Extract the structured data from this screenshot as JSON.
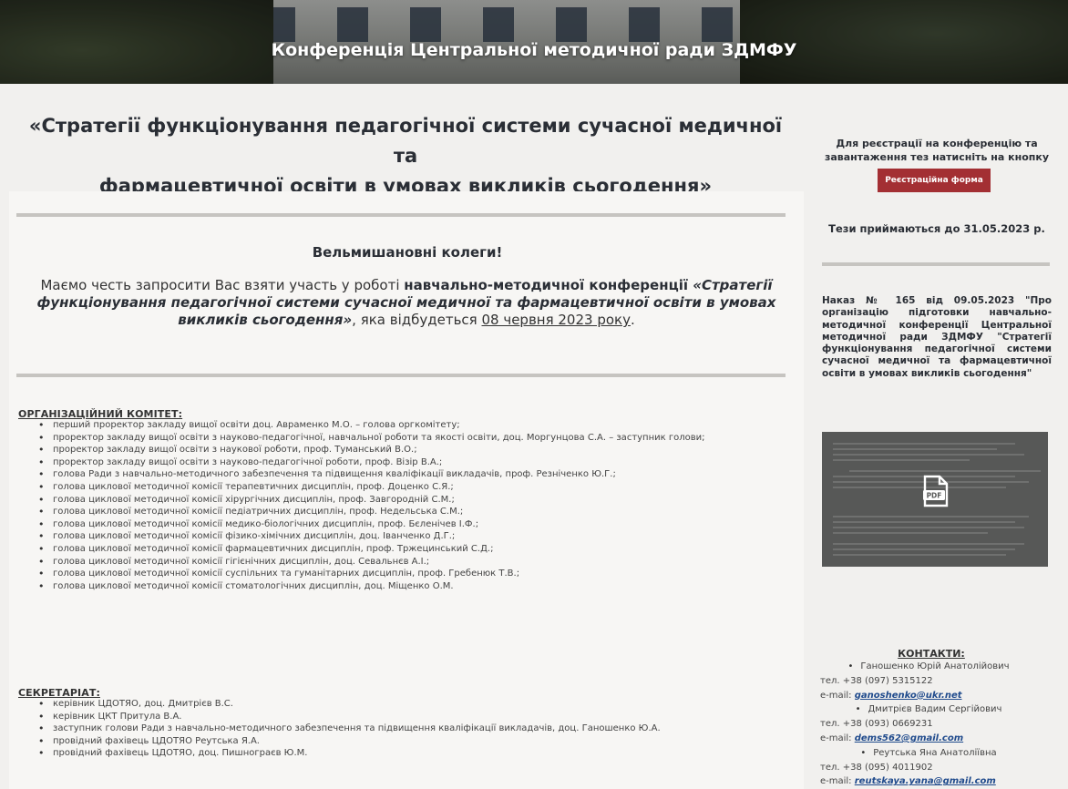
{
  "banner": {
    "title": "Конференція Центральної методичної ради ЗДМФУ"
  },
  "main": {
    "conf_title_line1": "«Стратегії функціонування педагогічної системи сучасної медичної та",
    "conf_title_line2": "фармацевтичної освіти в умовах викликів сьогодення»",
    "greeting": "Вельмишановні колеги!",
    "intro_pre": "Маємо честь запросити Вас взяти участь у роботі ",
    "intro_bold": "навчально-методичної  конференції ",
    "intro_italic": "«Стратегії функціонування педагогічної системи сучасної медичної та фармацевтичної освіти в умовах викликів сьогодення»",
    "intro_mid": ", яка відбудеться ",
    "intro_date": "08 червня 2023 року",
    "intro_end": ".",
    "committee_title": "ОРГАНІЗАЦІЙНИЙ КОМІТЕТ:",
    "committee": [
      "перший проректор закладу вищої освіти доц. Авраменко М.О. – голова оргкомітету;",
      "проректор закладу вищої освіти з науково-педагогічної, навчальної роботи та якості освіти, доц. Моргунцова С.А. – заступник голови;",
      "проректор закладу вищої освіти з наукової роботи, проф. Туманський В.О.;",
      "проректор закладу вищої освіти з науково-педагогічної роботи, проф. Візір В.А.;",
      "голова Ради з навчально-методичного забезпечення та підвищення кваліфікації викладачів, проф. Резніченко Ю.Г.;",
      "голова циклової методичної комісії терапевтичних дисциплін, проф. Доценко С.Я.;",
      "голова циклової методичної комісії хірургічних дисциплін, проф. Завгородній С.М.;",
      "голова циклової методичної комісії педіатричних дисциплін, проф. Недельська С.М.;",
      "голова циклової методичної комісії медико-біологічних дисциплін, проф. Бєленічев І.Ф.;",
      "голова циклової методичної комісії фізико-хімічних дисциплін, доц. Іванченко Д.Г.;",
      "голова циклової методичної комісії фармацевтичних дисциплін, проф. Тржецинський С.Д.;",
      "голова циклової методичної комісії гігієнічних дисциплін, доц. Севальнєв А.І.;",
      "голова циклової методичної комісії суспільних та гуманітарних дисциплін, проф. Гребенюк Т.В.;",
      "голова циклової методичної комісії стоматологічних дисциплін, доц. Міщенко О.М."
    ],
    "secretariat_title": "СЕКРЕТАРІАТ:",
    "secretariat": [
      "керівник ЦДОТЯО, доц. Дмитрієв В.С.",
      "керівник ЦКТ Притула В.А.",
      "заступник голови Ради з навчально-методичного забезпечення та підвищення кваліфікації викладачів, доц. Ганошенко Ю.А.",
      "провідний фахівець ЦДОТЯО Реутська Я.А.",
      "провідний фахівець ЦДОТЯО, доц. Пишнограєв Ю.М."
    ]
  },
  "sidebar": {
    "reg_text": "Для реєстрації на конференцію та завантаження тез натисніть на кнопку",
    "reg_button": "Реєстраційна форма",
    "deadline": "Тези приймаються до 31.05.2023 р.",
    "order": "Наказ № 165 від 09.05.2023 \"Про організацію підготовки навчально-методичної конференції Центральної методичної ради ЗДМФУ \"Стратегії функціонування педагогічної системи сучасної медичної та фармацевтичної освіти в умовах викликів сьогодення\"",
    "pdf_icon": "pdf-file-icon",
    "contacts_title": "КОНТАКТИ:",
    "contacts": [
      {
        "name": "Ганошенко Юрій Анатолійович",
        "phone": "тел. +38 (097) 5315122",
        "mail_label": "e-mail: ",
        "email": "ganoshenko@ukr.net"
      },
      {
        "name": "Дмитрієв Вадим Сергійович",
        "phone": "тел. +38 (093) 0669231",
        "mail_label": "e-mail: ",
        "email": "dems562@gmail.com"
      },
      {
        "name": "Реутська Яна Анатоліївна",
        "phone": "тел. +38 (095) 4011902",
        "mail_label": "e-mail: ",
        "email": "reutskaya.yana@gmail.com"
      }
    ]
  },
  "colors": {
    "button": "#a32f33",
    "background": "#f1f0ee",
    "link": "#1f4a8c"
  }
}
